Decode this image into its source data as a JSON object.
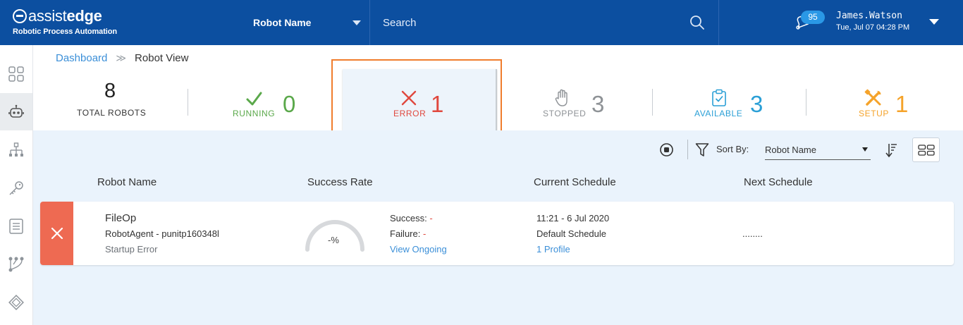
{
  "header": {
    "logo_word_light": "assist",
    "logo_word_bold": "edge",
    "logo_subtitle": "Robotic Process Automation",
    "robot_select": "Robot Name",
    "search_placeholder": "Search",
    "notification_count": "95",
    "user_name": "James.Watson",
    "user_datetime": "Tue, Jul 07 04:28 PM",
    "colors": {
      "bg": "#0c4fa0",
      "badge": "#2a98e6"
    }
  },
  "sidebar": {
    "items": [
      {
        "icon": "dashboard-grid-icon"
      },
      {
        "icon": "robot-icon",
        "active": true
      },
      {
        "icon": "hierarchy-icon"
      },
      {
        "icon": "key-icon"
      },
      {
        "icon": "document-list-icon"
      },
      {
        "icon": "workflow-icon"
      },
      {
        "icon": "diamond-icon"
      }
    ]
  },
  "breadcrumb": {
    "home": "Dashboard",
    "separator": "≫",
    "current": "Robot View"
  },
  "stats": {
    "total": {
      "value": "8",
      "label": "TOTAL ROBOTS"
    },
    "running": {
      "value": "0",
      "label": "RUNNING",
      "color": "#5aa84a"
    },
    "error": {
      "value": "1",
      "label": "ERROR",
      "color": "#e0483e"
    },
    "stopped": {
      "value": "3",
      "label": "STOPPED",
      "color": "#8e9296"
    },
    "available": {
      "value": "3",
      "label": "AVAILABLE",
      "color": "#2a9fd6"
    },
    "setup": {
      "value": "1",
      "label": "SETUP",
      "color": "#f5a32a"
    }
  },
  "toolbar": {
    "sort_label": "Sort By:",
    "sort_value": "Robot Name"
  },
  "table": {
    "columns": [
      "Robot Name",
      "Success Rate",
      "Current Schedule",
      "Next Schedule"
    ],
    "rows": [
      {
        "name": "FileOp",
        "agent": "RobotAgent - punitp160348l",
        "status_text": "Startup Error",
        "success_rate": "-%",
        "success_label": "Success:",
        "success_value": "-",
        "failure_label": "Failure:",
        "failure_value": "-",
        "view_link": "View Ongoing",
        "current_schedule_time": "11:21 - 6 Jul 2020",
        "current_schedule_name": "Default Schedule",
        "profile_link": "1 Profile",
        "next_schedule": "........"
      }
    ]
  }
}
